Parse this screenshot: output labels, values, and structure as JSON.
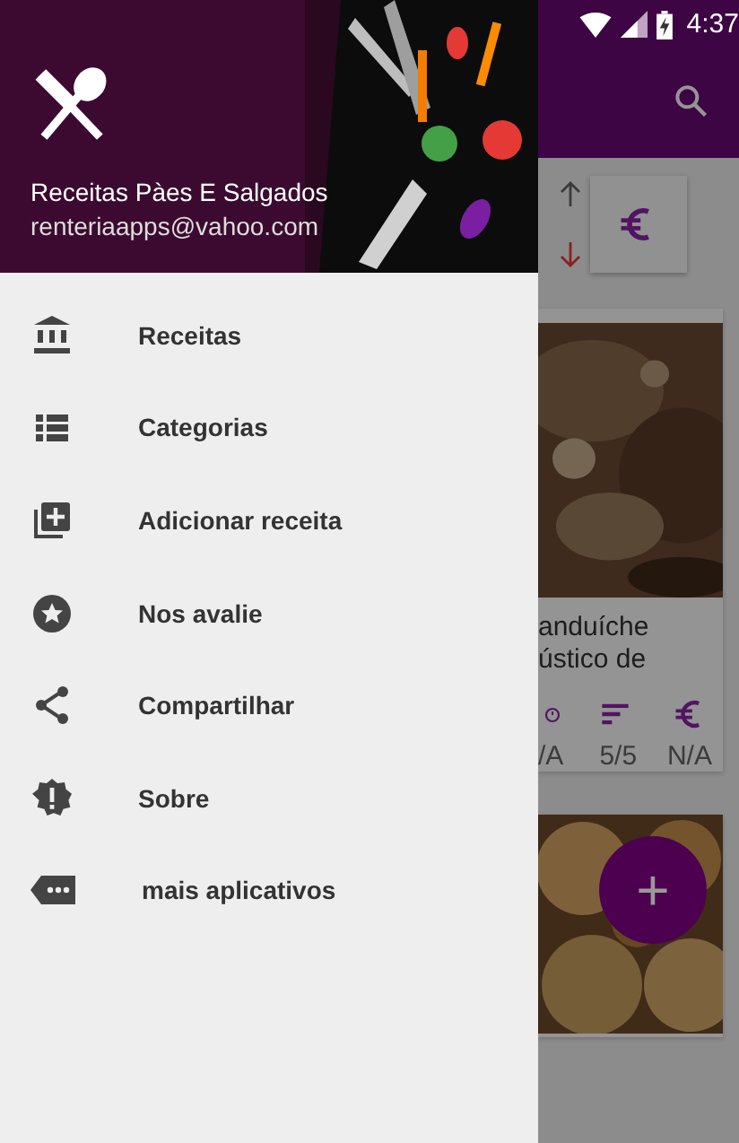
{
  "status_bar": {
    "time": "4:37"
  },
  "header": {
    "title": "Receitas Pàes E Salgados",
    "email": "renteriaapps@vahoo.com"
  },
  "menu": [
    {
      "label": "Receitas"
    },
    {
      "label": "Categorias"
    },
    {
      "label": "Adicionar receita"
    },
    {
      "label": "Nos avalie"
    },
    {
      "label": "Compartilhar"
    },
    {
      "label": "Sobre"
    },
    {
      "label": "mais aplicativos"
    }
  ],
  "background": {
    "card_title_lines": [
      "anduíche",
      "ústico de"
    ],
    "stats": [
      "/A",
      "5/5",
      "N/A"
    ],
    "fab": "+"
  }
}
